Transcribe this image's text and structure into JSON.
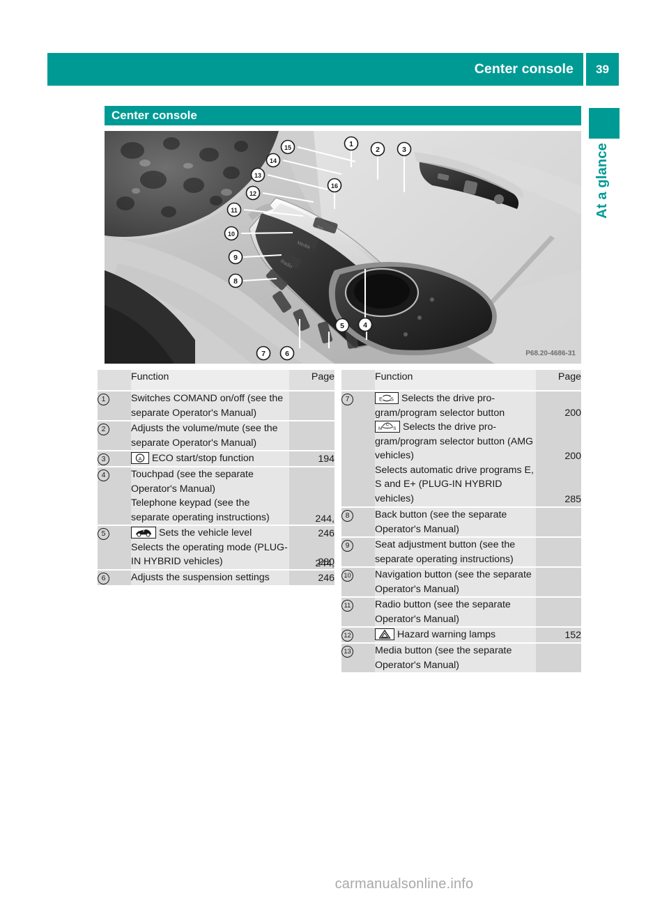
{
  "header": {
    "running_title": "Center console",
    "page_number": "39"
  },
  "thumb_tab": {
    "label": "At a glance"
  },
  "section": {
    "title": "Center console"
  },
  "photo": {
    "alt": "Center console overview photograph",
    "image_code": "P68.20-4686-31",
    "callouts": [
      "1",
      "2",
      "3",
      "4",
      "5",
      "6",
      "7",
      "8",
      "9",
      "10",
      "11",
      "12",
      "13",
      "14",
      "15",
      "16"
    ]
  },
  "colors": {
    "teal": "#009a95",
    "row_num_bg": "#d4d4d4",
    "row_fn_bg": "#e6e6e6",
    "header_num_bg": "#dedede",
    "header_fn_bg": "#ededed",
    "text": "#1a1a1a",
    "watermark": "#a8a8a8"
  },
  "table_left": {
    "headers": {
      "num": "",
      "function": "Function",
      "page": "Page"
    },
    "rows": [
      {
        "num": "1",
        "icon": null,
        "blocks": [
          {
            "text": "Switches COMAND on/off (see the separate Opera­tor's Manual)",
            "page": ""
          }
        ]
      },
      {
        "num": "2",
        "icon": null,
        "blocks": [
          {
            "text": "Adjusts the volume/mute (see the separate Opera­tor's Manual)",
            "page": ""
          }
        ]
      },
      {
        "num": "3",
        "icon": "eco-start-stop-icon",
        "blocks": [
          {
            "text": "ECO start/stop func­tion",
            "page": "194"
          }
        ]
      },
      {
        "num": "4",
        "icon": null,
        "blocks": [
          {
            "text": "Touchpad (see the separate Operator's Manual)",
            "page": ""
          },
          {
            "text": "Telephone keypad (see the separate operating instruc­tions)",
            "page": ""
          }
        ]
      },
      {
        "num": "5",
        "icon": "vehicle-level-icon",
        "blocks": [
          {
            "text": "Sets the vehicle level",
            "page": "244, 246"
          },
          {
            "text": "Selects the operating mode (PLUG-IN HYBRID vehicles)",
            "page": "280"
          }
        ]
      },
      {
        "num": "6",
        "icon": null,
        "blocks": [
          {
            "text": "Adjusts the suspension set­tings",
            "page": "244, 246"
          }
        ]
      }
    ]
  },
  "table_right": {
    "headers": {
      "num": "",
      "function": "Function",
      "page": "Page"
    },
    "rows": [
      {
        "num": "7",
        "icon": null,
        "blocks": [
          {
            "icon": "drive-program-es-icon",
            "text": "Selects the drive pro­gram/program selector button",
            "page": "200"
          },
          {
            "icon": "drive-program-mcs-icon",
            "text": "Selects the drive pro­gram/program selector button (AMG vehicles)",
            "page": "200"
          },
          {
            "icon": null,
            "text": "Selects automatic drive programs E, S and E+ (PLUG-IN HYBRID vehicles)",
            "page": "285"
          }
        ]
      },
      {
        "num": "8",
        "icon": null,
        "blocks": [
          {
            "text": "Back button (see the sepa­rate Operator's Manual)",
            "page": ""
          }
        ]
      },
      {
        "num": "9",
        "icon": null,
        "blocks": [
          {
            "text": "Seat adjustment button (see the separate operating instructions)",
            "page": ""
          }
        ]
      },
      {
        "num": "10",
        "icon": null,
        "blocks": [
          {
            "text": "Navigation button (see the separate Operator's Man­ual)",
            "page": ""
          }
        ]
      },
      {
        "num": "11",
        "icon": null,
        "blocks": [
          {
            "text": "Radio button (see the sep­arate Operator's Manual)",
            "page": ""
          }
        ]
      },
      {
        "num": "12",
        "icon": "hazard-warning-icon",
        "blocks": [
          {
            "text": "Hazard warning lamps",
            "page": "152"
          }
        ]
      },
      {
        "num": "13",
        "icon": null,
        "blocks": [
          {
            "text": "Media button (see the sep­arate Operator's Manual)",
            "page": ""
          }
        ]
      }
    ]
  },
  "watermark": {
    "text": "carmanualsonline.info"
  }
}
